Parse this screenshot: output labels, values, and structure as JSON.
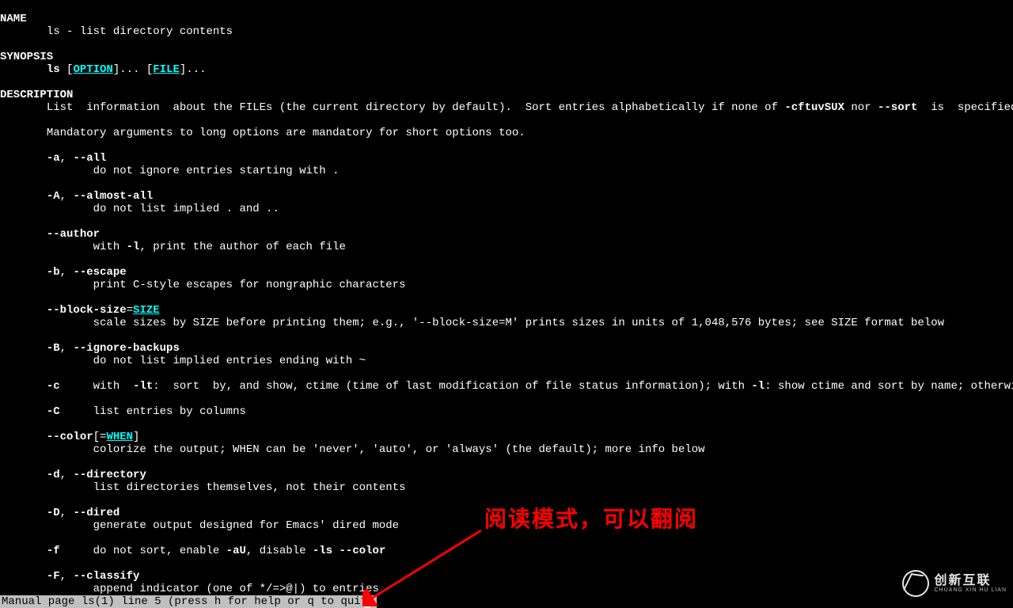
{
  "sections": {
    "name_hdr": "NAME",
    "name_body": "ls - list directory contents",
    "syn_hdr": "SYNOPSIS",
    "syn_cmd": "ls",
    "syn_opt": "OPTION",
    "syn_file": "FILE",
    "desc_hdr": "DESCRIPTION",
    "desc_p1a": "List  information  about the FILEs (the current directory by default).  Sort entries alphabetically if none of ",
    "desc_p1b": "-cftuvSUX",
    "desc_p1c": " nor ",
    "desc_p1d": "--sort",
    "desc_p1e": "  is  specified.",
    "desc_p2": "Mandatory arguments to long options are mandatory for short options too."
  },
  "opts": {
    "a": {
      "flag1": "-a",
      "flag2": "--all",
      "desc": "do not ignore entries starting with ."
    },
    "A": {
      "flag1": "-A",
      "flag2": "--almost-all",
      "desc": "do not list implied . and .."
    },
    "author": {
      "flag": "--author",
      "desc_a": "with ",
      "desc_b": "-l",
      "desc_c": ", print the author of each file"
    },
    "b": {
      "flag1": "-b",
      "flag2": "--escape",
      "desc": "print C-style escapes for nongraphic characters"
    },
    "block": {
      "flag": "--block-size",
      "arg": "SIZE",
      "desc": "scale sizes by SIZE before printing them; e.g., '--block-size=M' prints sizes in units of 1,048,576 bytes; see SIZE format below"
    },
    "B": {
      "flag1": "-B",
      "flag2": "--ignore-backups",
      "desc": "do not list implied entries ending with ~"
    },
    "c": {
      "flag": "-c",
      "desc_a": "with  ",
      "lt": "-lt",
      "desc_b": ":  sort  by, and show, ctime (time of last modification of file status information); with ",
      "l": "-l",
      "desc_c": ": show ctime and sort by name; otherwise: sort by ctime, newest first"
    },
    "C": {
      "flag": "-C",
      "desc": "list entries by columns"
    },
    "color": {
      "flag": "--color",
      "arg": "WHEN",
      "desc": "colorize the output; WHEN can be 'never', 'auto', or 'always' (the default); more info below"
    },
    "d": {
      "flag1": "-d",
      "flag2": "--directory",
      "desc": "list directories themselves, not their contents"
    },
    "D": {
      "flag1": "-D",
      "flag2": "--dired",
      "desc": "generate output designed for Emacs' dired mode"
    },
    "f": {
      "flag": "-f",
      "desc_a": "do not sort, enable ",
      "aU": "-aU",
      "desc_b": ", disable ",
      "ls": "-ls",
      "sp": " ",
      "color": "--color"
    },
    "F": {
      "flag1": "-F",
      "flag2": "--classify",
      "desc": "append indicator (one of */=>@|) to entries"
    }
  },
  "status": " Manual page ls(1) line 5 (press h for help or q to quit)",
  "annotation_text": "阅读模式，可以翻阅",
  "brand": {
    "name": "创新互联",
    "sub": "CHUANG XIN HU LIAN"
  }
}
